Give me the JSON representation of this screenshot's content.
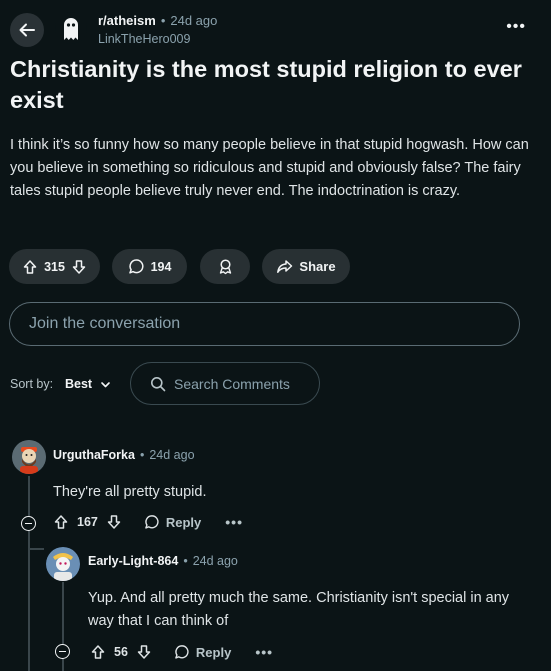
{
  "post": {
    "subreddit": "r/atheism",
    "separator": "•",
    "age": "24d ago",
    "author": "LinkTheHero009",
    "more": "•••",
    "title": "Christianity is the most stupid religion to ever exist",
    "body": "I think it’s so funny how so many people believe in that stupid hogwash. How can you believe in something so ridiculous and stupid and obviously false? The fairy tales stupid people believe truly never end. The indoctrination is crazy."
  },
  "actions": {
    "upvotes": "315",
    "comments": "194",
    "share_label": "Share"
  },
  "composer": {
    "placeholder": "Join the conversation"
  },
  "sort": {
    "label": "Sort by:",
    "value": "Best",
    "search_placeholder": "Search Comments"
  },
  "comments": [
    {
      "user": "UrguthaForka",
      "separator": "•",
      "age": "24d ago",
      "text": "They're all pretty stupid.",
      "votes": "167",
      "reply_label": "Reply",
      "more": "•••"
    },
    {
      "user": "Early-Light-864",
      "separator": "•",
      "age": "24d ago",
      "text": "Yup. And all pretty much the same. Christianity isn't special in any way that I can think of",
      "votes": "56",
      "reply_label": "Reply",
      "more": "•••"
    }
  ],
  "colors": {
    "background": "#0b1416",
    "pill": "#283033",
    "text": "#f2f4f5",
    "muted": "#8ba2ad"
  }
}
